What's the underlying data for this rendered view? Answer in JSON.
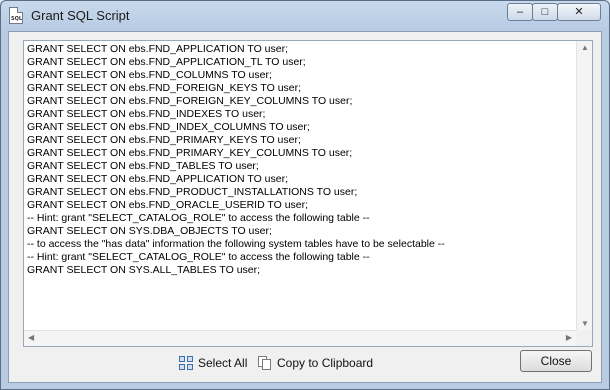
{
  "window": {
    "title": "Grant SQL Script",
    "icon": "sql-file-icon",
    "icon_text": "SQL"
  },
  "controls": {
    "minimize_glyph": "–",
    "maximize_glyph": "□",
    "close_glyph": "✕"
  },
  "script": {
    "lines": [
      "GRANT SELECT ON ebs.FND_APPLICATION TO user;",
      "GRANT SELECT ON ebs.FND_APPLICATION_TL TO user;",
      "GRANT SELECT ON ebs.FND_COLUMNS TO user;",
      "GRANT SELECT ON ebs.FND_FOREIGN_KEYS TO user;",
      "GRANT SELECT ON ebs.FND_FOREIGN_KEY_COLUMNS TO user;",
      "GRANT SELECT ON ebs.FND_INDEXES TO user;",
      "GRANT SELECT ON ebs.FND_INDEX_COLUMNS TO user;",
      "GRANT SELECT ON ebs.FND_PRIMARY_KEYS TO user;",
      "GRANT SELECT ON ebs.FND_PRIMARY_KEY_COLUMNS TO user;",
      "GRANT SELECT ON ebs.FND_TABLES TO user;",
      "GRANT SELECT ON ebs.FND_APPLICATION TO user;",
      "GRANT SELECT ON ebs.FND_PRODUCT_INSTALLATIONS TO user;",
      "GRANT SELECT ON ebs.FND_ORACLE_USERID TO user;",
      "-- Hint: grant \"SELECT_CATALOG_ROLE\" to access the following table --",
      "GRANT SELECT ON SYS.DBA_OBJECTS TO user;",
      "-- to access the \"has data\" information the following system tables have to be selectable --",
      "-- Hint: grant \"SELECT_CATALOG_ROLE\" to access the following table --",
      "GRANT SELECT ON SYS.ALL_TABLES TO user;"
    ]
  },
  "scrollbars": {
    "up_glyph": "▲",
    "down_glyph": "▼",
    "left_glyph": "◀",
    "right_glyph": "▶"
  },
  "buttons": {
    "select_all": "Select All",
    "select_all_icon": "select-all-grid-icon",
    "copy": "Copy to Clipboard",
    "copy_icon": "clipboard-copy-icon",
    "close": "Close"
  }
}
